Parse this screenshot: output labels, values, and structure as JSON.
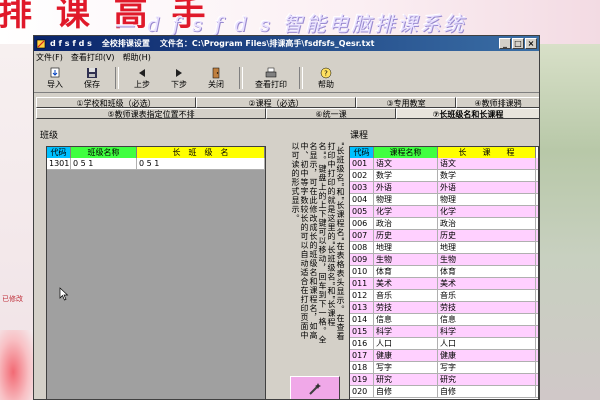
{
  "banner": {
    "title_red": "排 课 高 手",
    "subtitle": "— d f s f d s 智能电脑排课系统"
  },
  "status_left": "已修改",
  "window": {
    "title": "d f s f d s",
    "title_mid": "全校排课设置",
    "title_file": "文件名：C:\\Program Files\\排课高手\\fsdfsfs_Qesr.txt"
  },
  "menu": [
    "文件(F)",
    "查看打印(V)",
    "帮助(H)"
  ],
  "toolbar": {
    "import": "导入",
    "save": "保存",
    "up": "上步",
    "down": "下步",
    "close": "关闭",
    "print": "查看打印",
    "help": "帮助"
  },
  "tabs_row1": [
    "①学校和班级（必选）",
    "②课程（必选）",
    "③专用教室",
    "④教师排课鸦"
  ],
  "tabs_row2": [
    "⑤教师课表指定位置不排",
    "⑥统一课",
    "⑦长班级名和长课程"
  ],
  "left_panel": {
    "title": "班级",
    "headers": [
      "代码",
      "班级名称",
      "长　班　级　名"
    ],
    "rows": [
      [
        "1301",
        "0 5 1",
        "0 5 1"
      ]
    ]
  },
  "middle_text": "\"长班级名\"和\"长课程名\"在表格表头显示。在查看打印中打印的就是这里的\"长班级名\"和\"长课程名\"。键盘上的上下键可以移动，回车到下一格。全名显示，可在此修改成长的班级名和课程名，如高中、初中等字数较长的可以自动适合在打印页面中以可读的形式显示。",
  "right_panel": {
    "title": "课程",
    "headers": [
      "代码",
      "课程名称",
      "长　　课　　程"
    ],
    "rows": [
      [
        "001",
        "语文",
        "语文"
      ],
      [
        "002",
        "数学",
        "数学"
      ],
      [
        "003",
        "外语",
        "外语"
      ],
      [
        "004",
        "物理",
        "物理"
      ],
      [
        "005",
        "化学",
        "化学"
      ],
      [
        "006",
        "政治",
        "政治"
      ],
      [
        "007",
        "历史",
        "历史"
      ],
      [
        "008",
        "地理",
        "地理"
      ],
      [
        "009",
        "生物",
        "生物"
      ],
      [
        "010",
        "体育",
        "体育"
      ],
      [
        "011",
        "美术",
        "美术"
      ],
      [
        "012",
        "音乐",
        "音乐"
      ],
      [
        "013",
        "劳技",
        "劳技"
      ],
      [
        "014",
        "信息",
        "信息"
      ],
      [
        "015",
        "科学",
        "科学"
      ],
      [
        "016",
        "人口",
        "人口"
      ],
      [
        "017",
        "健康",
        "健康"
      ],
      [
        "018",
        "写字",
        "写字"
      ],
      [
        "019",
        "研究",
        "研究"
      ],
      [
        "020",
        "自修",
        "自修"
      ]
    ]
  },
  "colors": {
    "header_code": "#00c0ff",
    "header_name": "#40ff40",
    "header_long": "#ffff00",
    "row_alt": "#ffd0ff"
  }
}
